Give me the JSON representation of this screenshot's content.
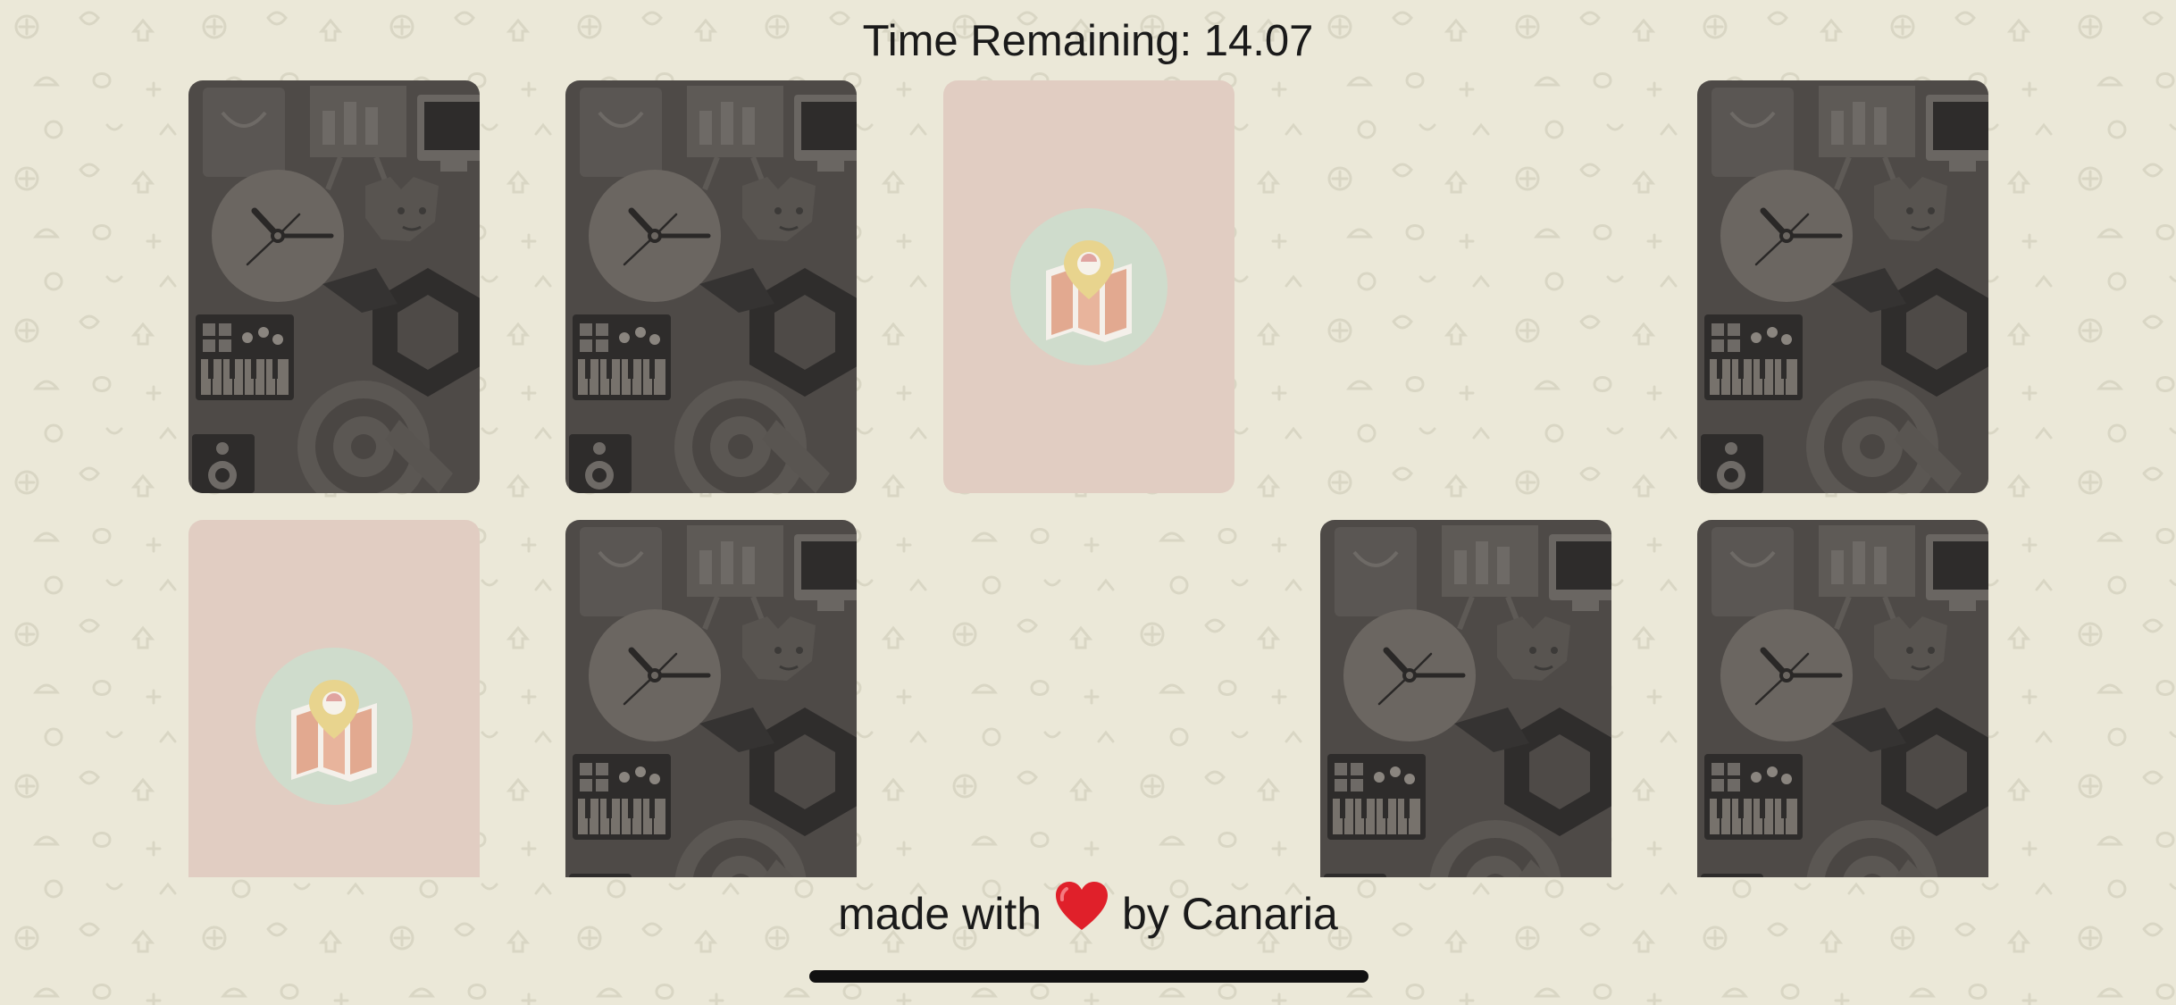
{
  "timer": {
    "label": "Time Remaining:",
    "value": "14.07"
  },
  "board": {
    "rows": 2,
    "columns": 5,
    "cards": [
      {
        "row": 1,
        "col": 1,
        "state": "face-down",
        "image": "card-back-pattern"
      },
      {
        "row": 1,
        "col": 2,
        "state": "face-down",
        "image": "card-back-pattern"
      },
      {
        "row": 1,
        "col": 3,
        "state": "face-up",
        "image": "map-pin-icon"
      },
      {
        "row": 1,
        "col": 4,
        "state": "matched-removed",
        "image": ""
      },
      {
        "row": 1,
        "col": 5,
        "state": "face-down",
        "image": "card-back-pattern"
      },
      {
        "row": 2,
        "col": 1,
        "state": "face-up",
        "image": "map-pin-icon"
      },
      {
        "row": 2,
        "col": 2,
        "state": "face-down",
        "image": "card-back-pattern"
      },
      {
        "row": 2,
        "col": 3,
        "state": "matched-removed",
        "image": ""
      },
      {
        "row": 2,
        "col": 4,
        "state": "face-down",
        "image": "card-back-pattern"
      },
      {
        "row": 2,
        "col": 5,
        "state": "face-down",
        "image": "card-back-pattern"
      }
    ]
  },
  "footer": {
    "prefix": "made with",
    "icon": "heart-icon",
    "suffix": "by Canaria"
  },
  "colors": {
    "background": "#ebe8d8",
    "card_back": "#4e4a47",
    "card_face": "#e1cdc2",
    "emblem_circle": "#cfdccc",
    "heart": "#e0202a"
  }
}
